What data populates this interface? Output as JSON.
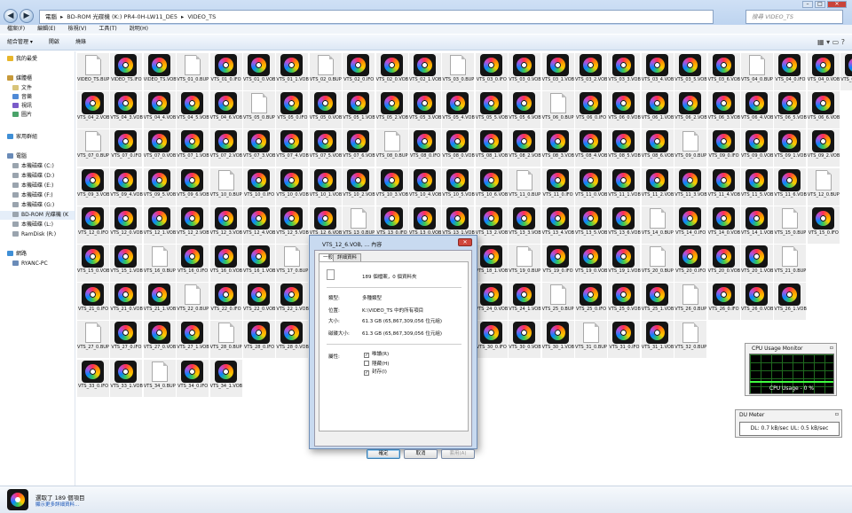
{
  "window": {
    "address": [
      "電腦",
      "BD-ROM 光碟機 (K:) PR4-0H-LW11_DE5",
      "VIDEO_TS"
    ],
    "search_placeholder": "搜尋 VIDEO_TS"
  },
  "menubar": [
    "檔案(F)",
    "編輯(E)",
    "檢視(V)",
    "工具(T)",
    "說明(H)"
  ],
  "toolbar": [
    "組合管理 ▾",
    "開啟",
    "燒錄"
  ],
  "nav": {
    "favorites": "我的最愛",
    "libraries": "媒體櫃",
    "library_items": [
      "文件",
      "音樂",
      "視訊",
      "圖片"
    ],
    "homegroup": "家用群組",
    "computer": "電腦",
    "drives": [
      "本機磁碟 (C:)",
      "本機磁碟 (D:)",
      "本機磁碟 (E:)",
      "本機磁碟 (F:)",
      "本機磁碟 (G:)",
      "BD-ROM 光碟機 (K",
      "本機磁碟 (L:)",
      "RamDisk (R:)"
    ],
    "network": "網路",
    "network_items": [
      "RYANC-PC"
    ]
  },
  "files": [
    [
      "VIDEO_TS.BUP",
      "VIDEO_TS.IFO",
      "VIDEO_TS.VOB",
      "VTS_01_0.BUP",
      "VTS_01_0.IFO",
      "VTS_01_0.VOB",
      "VTS_01_1.VOB",
      "VTS_02_0.BUP",
      "VTS_02_0.IFO",
      "VTS_02_0.VOB",
      "VTS_02_1.VOB",
      "VTS_03_0.BUP",
      "VTS_03_0.IFO",
      "VTS_03_0.VOB",
      "VTS_03_1.VOB",
      "VTS_03_2.VOB",
      "VTS_03_3.VOB",
      "VTS_03_4.VOB",
      "VTS_03_5.VOB",
      "VTS_03_6.VOB",
      "VTS_04_0.BUP",
      "VTS_04_0.IFO",
      "VTS_04_0.VOB",
      "VTS_04_1.VOB"
    ],
    [
      "VTS_04_2.VOB",
      "VTS_04_3.VOB",
      "VTS_04_4.VOB",
      "VTS_04_5.VOB",
      "VTS_04_6.VOB",
      "VTS_05_0.BUP",
      "VTS_05_0.IFO",
      "VTS_05_0.VOB",
      "VTS_05_1.VOB",
      "VTS_05_2.VOB",
      "VTS_05_3.VOB",
      "VTS_05_4.VOB",
      "VTS_05_5.VOB",
      "VTS_05_6.VOB",
      "VTS_06_0.BUP",
      "VTS_06_0.IFO",
      "VTS_06_0.VOB",
      "VTS_06_1.VOB",
      "VTS_06_2.VOB",
      "VTS_06_3.VOB",
      "VTS_06_4.VOB",
      "VTS_06_5.VOB",
      "VTS_06_6.VOB"
    ],
    [
      "VTS_07_0.BUP",
      "VTS_07_0.IFO",
      "VTS_07_0.VOB",
      "VTS_07_1.VOB",
      "VTS_07_2.VOB",
      "VTS_07_3.VOB",
      "VTS_07_4.VOB",
      "VTS_07_5.VOB",
      "VTS_07_6.VOB",
      "VTS_08_0.BUP",
      "VTS_08_0.IFO",
      "VTS_08_0.VOB",
      "VTS_08_1.VOB",
      "VTS_08_2.VOB",
      "VTS_08_3.VOB",
      "VTS_08_4.VOB",
      "VTS_08_5.VOB",
      "VTS_08_6.VOB",
      "VTS_09_0.BUP",
      "VTS_09_0.IFO",
      "VTS_09_0.VOB",
      "VTS_09_1.VOB",
      "VTS_09_2.VOB"
    ],
    [
      "VTS_09_3.VOB",
      "VTS_09_4.VOB",
      "VTS_09_5.VOB",
      "VTS_09_6.VOB",
      "VTS_10_0.BUP",
      "VTS_10_0.IFO",
      "VTS_10_0.VOB",
      "VTS_10_1.VOB",
      "VTS_10_2.VOB",
      "VTS_10_3.VOB",
      "VTS_10_4.VOB",
      "VTS_10_5.VOB",
      "VTS_10_6.VOB",
      "VTS_11_0.BUP",
      "VTS_11_0.IFO",
      "VTS_11_0.VOB",
      "VTS_11_1.VOB",
      "VTS_11_2.VOB",
      "VTS_11_3.VOB",
      "VTS_11_4.VOB",
      "VTS_11_5.VOB",
      "VTS_11_6.VOB",
      "VTS_12_0.BUP"
    ],
    [
      "VTS_12_0.IFO",
      "VTS_12_0.VOB",
      "VTS_12_1.VOB",
      "VTS_12_2.VOB",
      "VTS_12_3.VOB",
      "VTS_12_4.VOB",
      "VTS_12_5.VOB",
      "VTS_12_6.VOB",
      "VTS_13_0.BUP",
      "VTS_13_0.IFO",
      "VTS_13_0.VOB",
      "VTS_13_1.VOB",
      "VTS_13_2.VOB",
      "VTS_13_3.VOB",
      "VTS_13_4.VOB",
      "VTS_13_5.VOB",
      "VTS_13_6.VOB",
      "VTS_14_0.BUP",
      "VTS_14_0.IFO",
      "VTS_14_0.VOB",
      "VTS_14_1.VOB",
      "VTS_15_0.BUP",
      "VTS_15_0.IFO"
    ],
    [
      "VTS_15_0.VOB",
      "VTS_15_1.VOB",
      "VTS_16_0.BUP",
      "VTS_16_0.IFO",
      "VTS_16_0.VOB",
      "VTS_16_1.VOB",
      "VTS_17_0.BUP",
      "VTS_17_0.IFO",
      "",
      "",
      "",
      "VTS_18_0.VOB",
      "VTS_18_1.VOB",
      "VTS_19_0.BUP",
      "VTS_19_0.IFO",
      "VTS_19_0.VOB",
      "VTS_19_1.VOB",
      "VTS_20_0.BUP",
      "VTS_20_0.IFO",
      "VTS_20_0.VOB",
      "VTS_20_1.VOB",
      "VTS_21_0.BUP"
    ],
    [
      "VTS_21_0.IFO",
      "VTS_21_0.VOB",
      "VTS_21_1.VOB",
      "VTS_22_0.BUP",
      "VTS_22_0.IFO",
      "VTS_22_0.VOB",
      "VTS_22_1.VOB",
      "",
      "",
      "",
      "",
      "VTS_24_0.IFO",
      "VTS_24_0.VOB",
      "VTS_24_1.VOB",
      "VTS_25_0.BUP",
      "VTS_25_0.IFO",
      "VTS_25_0.VOB",
      "VTS_25_1.VOB",
      "VTS_26_0.BUP",
      "VTS_26_0.IFO",
      "VTS_26_0.VOB",
      "VTS_26_1.VOB"
    ],
    [
      "VTS_27_0.BUP",
      "VTS_27_0.IFO",
      "VTS_27_0.VOB",
      "VTS_27_1.VOB",
      "VTS_28_0.BUP",
      "VTS_28_0.IFO",
      "VTS_28_0.VOB",
      "",
      "",
      "",
      "",
      "VTS_30_0.BUP",
      "VTS_30_0.IFO",
      "VTS_30_0.VOB",
      "VTS_30_1.VOB",
      "VTS_31_0.BUP",
      "VTS_31_0.IFO",
      "VTS_31_1.VOB",
      "VTS_32_0.BUP"
    ],
    [
      "VTS_33_0.IFO",
      "VTS_33_1.VOB",
      "VTS_34_0.BUP",
      "VTS_34_0.IFO",
      "VTS_34_1.VOB"
    ]
  ],
  "dialog": {
    "title": "VTS_12_6.VOB, ... 內容",
    "tabs": [
      "一般",
      "詳細資料"
    ],
    "summary": "189 個檔案，0 個資料夾",
    "rows": [
      {
        "k": "類型:",
        "v": "多種類型"
      },
      {
        "k": "位置:",
        "v": "K:\\VIDEO_TS 中的所有項目"
      },
      {
        "k": "大小:",
        "v": "61.3 GB (65,867,309,056 位元組)"
      },
      {
        "k": "磁碟大小:",
        "v": "61.3 GB (65,867,309,056 位元組)"
      }
    ],
    "attr_label": "屬性:",
    "attrs": [
      {
        "label": "唯讀(R)",
        "checked": "✓"
      },
      {
        "label": "隱藏(H)",
        "checked": ""
      },
      {
        "label": "封存(I)",
        "checked": "✓"
      }
    ],
    "buttons": [
      "確定",
      "取消",
      "套用(A)"
    ]
  },
  "status": {
    "line1": "選取了 189 個項目",
    "line2": "顯示更多詳細資料..."
  },
  "cpu": {
    "title": "CPU Usage Monitor",
    "label": "CPU Usage - 0 %"
  },
  "du": {
    "title": "DU Meter",
    "value": "DL: 0.7 kB/sec  UL: 0.5 kB/sec"
  }
}
